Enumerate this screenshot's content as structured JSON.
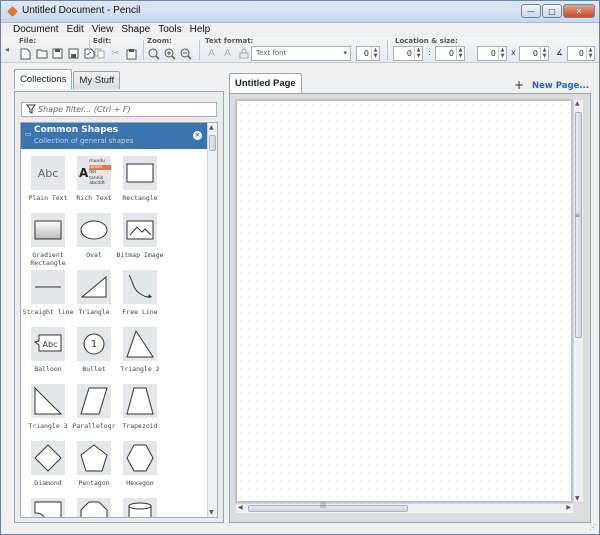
{
  "window": {
    "title": "Untitled Document - Pencil",
    "controls": {
      "minimize": "—",
      "maximize": "□",
      "close": "✕"
    }
  },
  "menu": [
    "Document",
    "Edit",
    "View",
    "Shape",
    "Tools",
    "Help"
  ],
  "toolbar": {
    "file_label": "File:",
    "edit_label": "Edit:",
    "zoom_label": "Zoom:",
    "text_format_label": "Text format:",
    "location_size_label": "Location & size:",
    "font_placeholder": "Text font",
    "font_size": "0",
    "x": "0",
    "y": "0",
    "width": "0",
    "height": "0",
    "angle": "0",
    "colon_sep": ":",
    "times_sep": "x",
    "angle_sep": "∡"
  },
  "collections_tab": "Collections",
  "mystuff_tab": "My Stuff",
  "filter_placeholder": "Shape filter... (Ctrl + F)",
  "collection": {
    "title": "Common Shapes",
    "description": "Collection of general shapes"
  },
  "shapes": [
    {
      "label": "Plain Text",
      "icon": "plain-text-icon"
    },
    {
      "label": "Rich Text",
      "icon": "rich-text-icon"
    },
    {
      "label": "Rectangle",
      "icon": "rectangle-icon"
    },
    {
      "label": "Gradient Rectangle",
      "icon": "gradient-rectangle-icon"
    },
    {
      "label": "Oval",
      "icon": "oval-icon"
    },
    {
      "label": "Bitmap Image",
      "icon": "bitmap-image-icon"
    },
    {
      "label": "Straight line",
      "icon": "straight-line-icon"
    },
    {
      "label": "Triangle",
      "icon": "triangle-icon"
    },
    {
      "label": "Free Line",
      "icon": "free-line-icon"
    },
    {
      "label": "Balloon",
      "icon": "balloon-icon"
    },
    {
      "label": "Bullet",
      "icon": "bullet-icon"
    },
    {
      "label": "Triangle 2",
      "icon": "triangle-2-icon"
    },
    {
      "label": "Triangle 3",
      "icon": "triangle-3-icon"
    },
    {
      "label": "Parallelogr",
      "icon": "parallelogram-icon"
    },
    {
      "label": "Trapezoid",
      "icon": "trapezoid-icon"
    },
    {
      "label": "Diamond",
      "icon": "diamond-icon"
    },
    {
      "label": "Pentagon",
      "icon": "pentagon-icon"
    },
    {
      "label": "Hexagon",
      "icon": "hexagon-icon"
    }
  ],
  "thumb_text": {
    "plain": "Abc",
    "rich_a": "A",
    "rich_lines": [
      "mundu",
      "lorem",
      "del tannis",
      "abcddt"
    ],
    "balloon": "Abc",
    "bullet": "1"
  },
  "page_tab": "Untitled Page",
  "new_page": "New Page...",
  "colors": {
    "accent": "#3c75ad",
    "link": "#2b63b2"
  }
}
